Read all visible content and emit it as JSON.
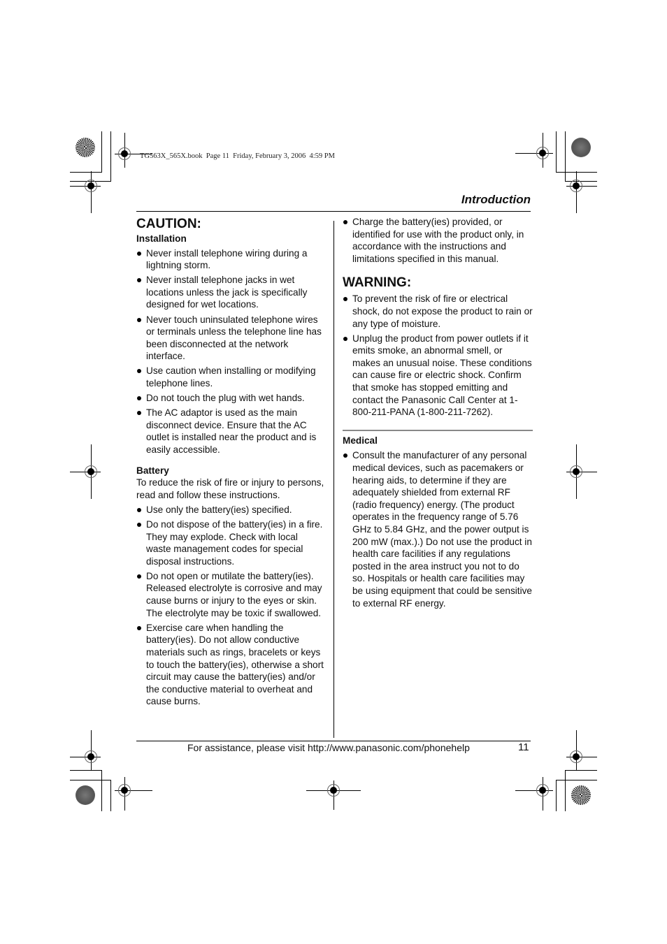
{
  "book_header": "TG563X_565X.book  Page 11  Friday, February 3, 2006  4:59 PM",
  "section_title": "Introduction",
  "caution": {
    "heading": "CAUTION:",
    "installation": {
      "heading": "Installation",
      "items": [
        "Never install telephone wiring during a lightning storm.",
        "Never install telephone jacks in wet locations unless the jack is specifically designed for wet locations.",
        "Never touch uninsulated telephone wires or terminals unless the telephone line has been disconnected at the network interface.",
        "Use caution when installing or modifying telephone lines.",
        "Do not touch the plug with wet hands.",
        "The AC adaptor is used as the main disconnect device. Ensure that the AC outlet is installed near the product and is easily accessible."
      ]
    },
    "battery": {
      "heading": "Battery",
      "intro": "To reduce the risk of fire or injury to persons, read and follow these instructions.",
      "items": [
        "Use only the battery(ies) specified.",
        "Do not dispose of the battery(ies) in a fire. They may explode. Check with local waste management codes for special disposal instructions.",
        "Do not open or mutilate the battery(ies). Released electrolyte is corrosive and may cause burns or injury to the eyes or skin. The electrolyte may be toxic if swallowed.",
        "Exercise care when handling the battery(ies). Do not allow conductive materials such as rings, bracelets or keys to touch the battery(ies), otherwise a short circuit may cause the battery(ies) and/or the conductive material to overheat and cause burns.",
        "Charge the battery(ies) provided, or identified for use with the product only, in accordance with the instructions and limitations specified in this manual."
      ]
    }
  },
  "warning": {
    "heading": "WARNING:",
    "items": [
      "To prevent the risk of fire or electrical shock, do not expose the product to rain or any type of moisture.",
      "Unplug the product from power outlets if it emits smoke, an abnormal smell, or makes an unusual noise. These conditions can cause fire or electric shock. Confirm that smoke has stopped emitting and contact the Panasonic Call Center at 1-800-211-PANA (1-800-211-7262)."
    ]
  },
  "medical": {
    "heading": "Medical",
    "items": [
      "Consult the manufacturer of any personal medical devices, such as pacemakers or hearing aids, to determine if they are adequately shielded from external RF (radio frequency) energy. (The product operates in the frequency range of 5.76 GHz to 5.84 GHz, and the power output is 200 mW (max.).) Do not use the product in health care facilities if any regulations posted in the area instruct you not to do so. Hospitals or health care facilities may be using equipment that could be sensitive to external RF energy."
    ]
  },
  "footer": {
    "text": "For assistance, please visit http://www.panasonic.com/phonehelp",
    "page_number": "11"
  },
  "icons": {
    "registration_mark": "registration-crosshair-icon",
    "color_disc": "printer-color-bar-icon"
  }
}
